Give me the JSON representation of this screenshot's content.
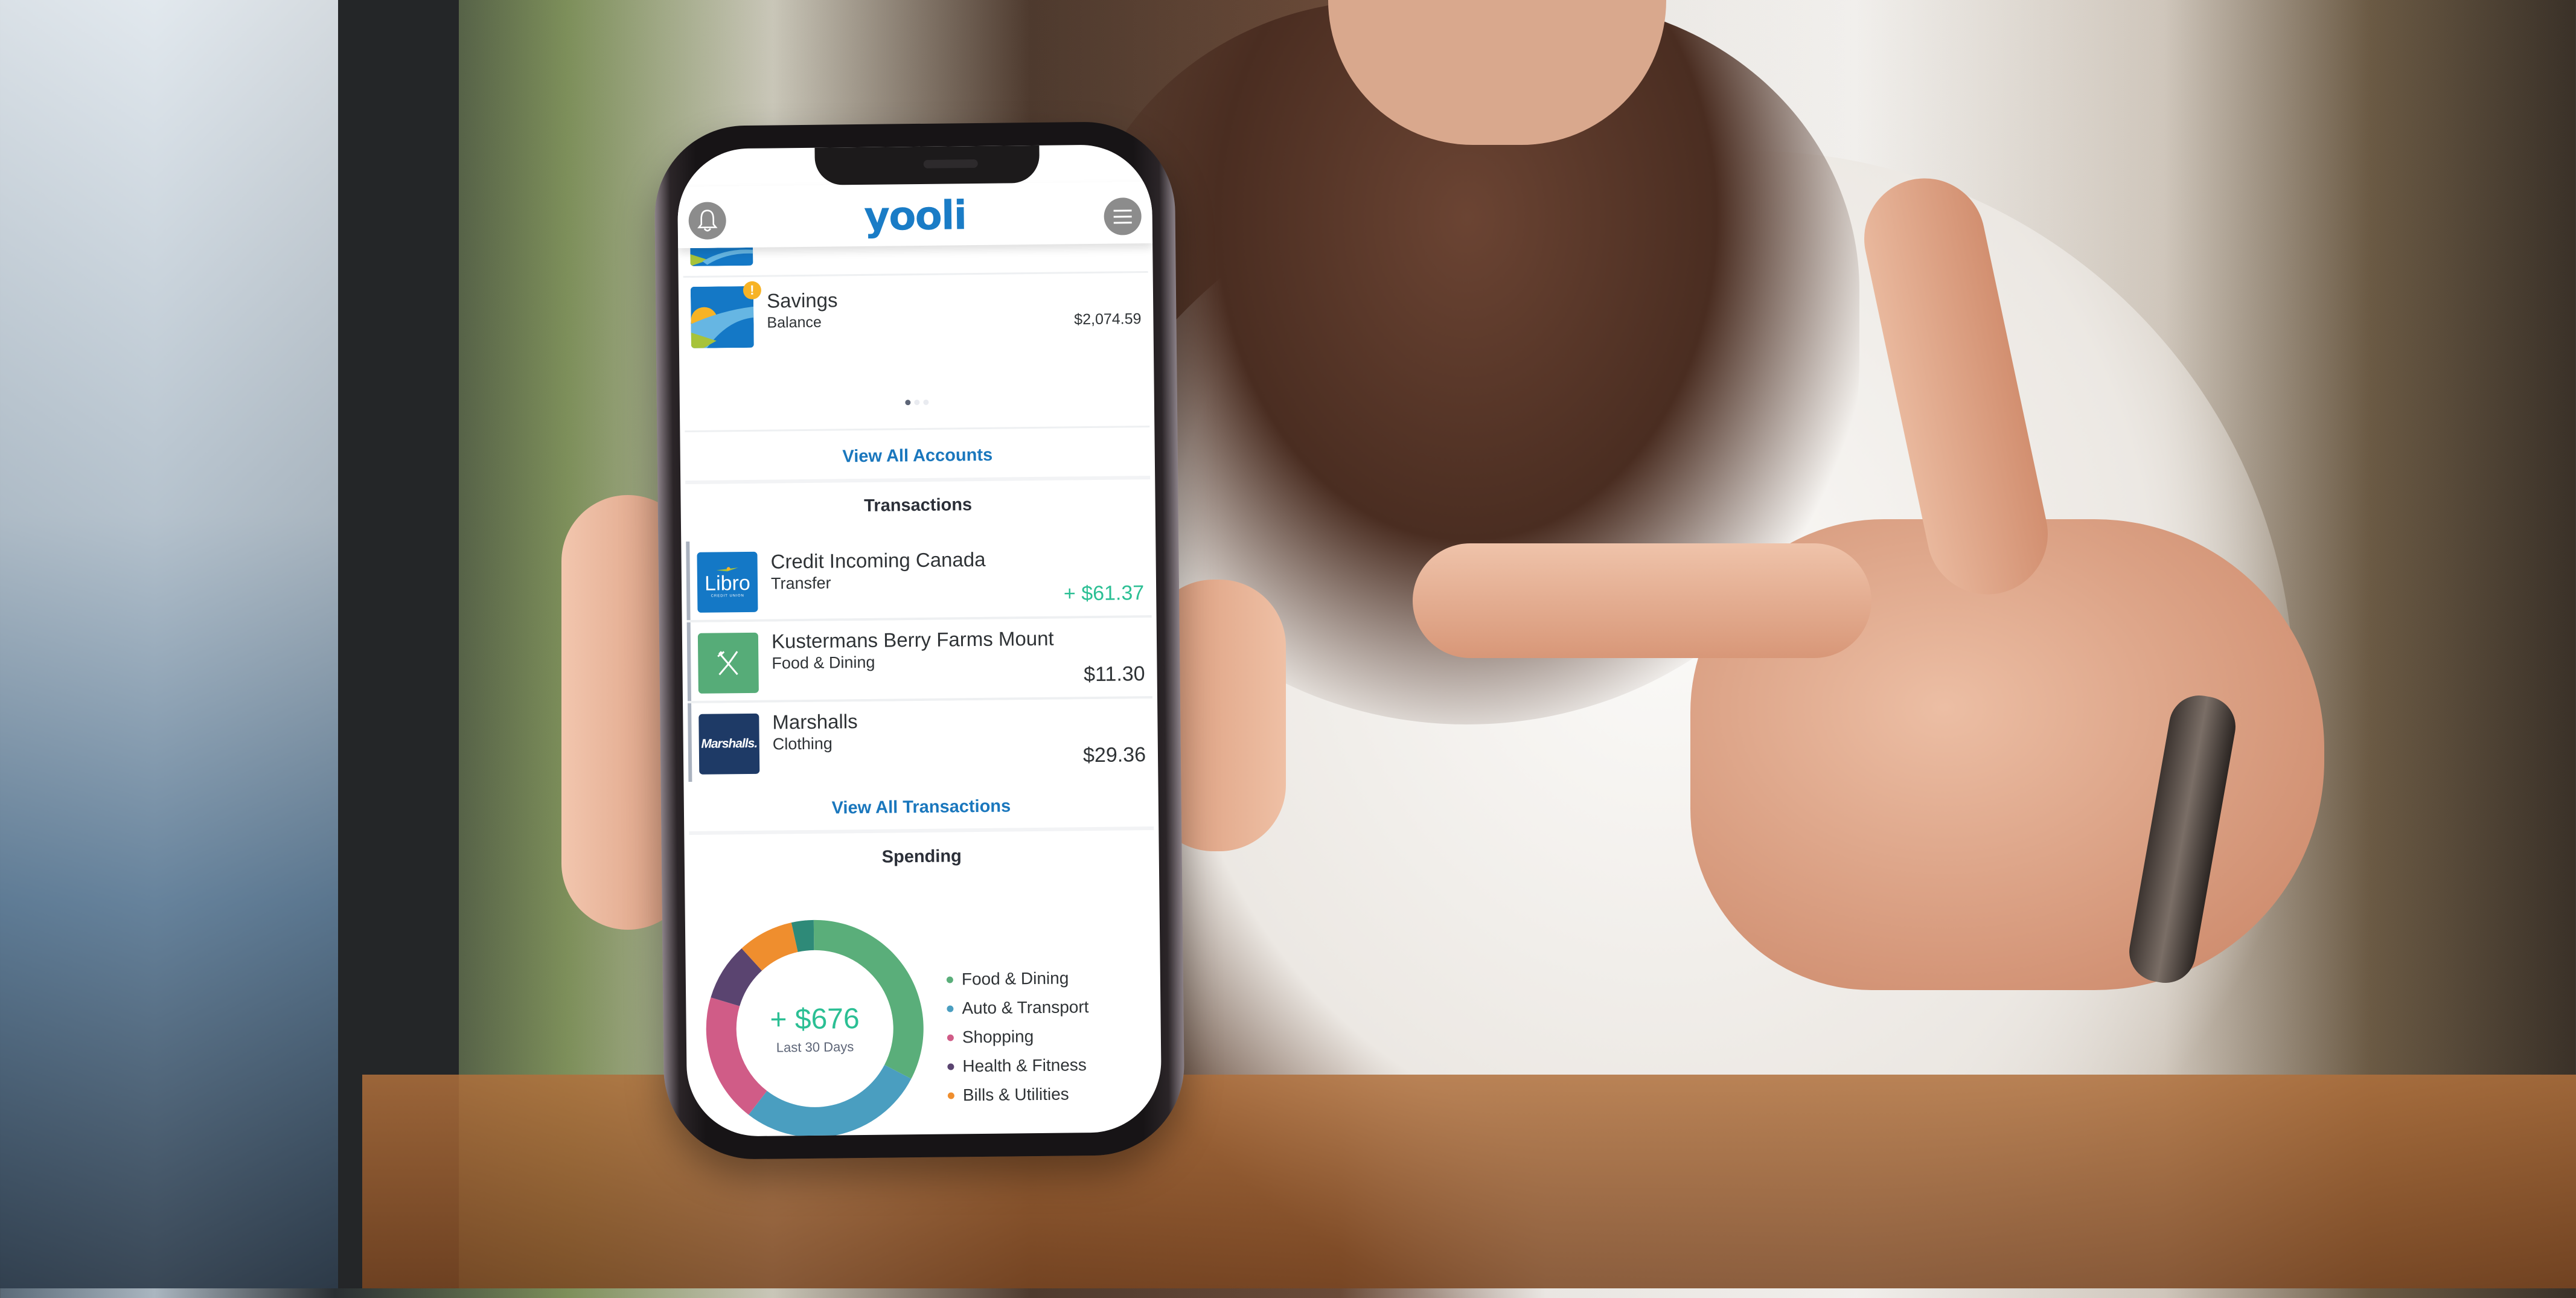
{
  "app": {
    "name": "yooli",
    "header": {
      "left_icon": "bell-icon",
      "right_icon": "hamburger-menu-icon"
    }
  },
  "accounts": {
    "items": [
      {
        "name": "Savings",
        "label": "Balance",
        "amount": "$2,074.59",
        "alert_badge": "!"
      }
    ],
    "carousel": {
      "count": 3,
      "active": 1
    },
    "view_all_label": "View All Accounts"
  },
  "transactions": {
    "title": "Transactions",
    "items": [
      {
        "merchant": "Credit Incoming Canada",
        "category": "Transfer",
        "amount": "+ $61.37",
        "direction": "credit",
        "logo_text": "Libro",
        "logo_subtext": "CREDIT UNION",
        "logo_color": "#1478c6"
      },
      {
        "merchant": "Kustermans Berry Farms Mount",
        "category": "Food & Dining",
        "amount": "$11.30",
        "direction": "debit",
        "logo_icon": "fork-knife-icon",
        "logo_color": "#56ac78"
      },
      {
        "merchant": "Marshalls",
        "category": "Clothing",
        "amount": "$29.36",
        "direction": "debit",
        "logo_text": "Marshalls.",
        "logo_color": "#1e3a66"
      }
    ],
    "view_all_label": "View All Transactions"
  },
  "spending": {
    "title": "Spending",
    "total": "+ $676",
    "period": "Last 30 Days",
    "carousel": {
      "count": 2,
      "active": 1
    }
  },
  "colors": {
    "brand": "#1a7cc6",
    "brand_light": "#5bb4e4",
    "positive": "#2bbf94",
    "link": "#1a77bd"
  },
  "chart_data": {
    "type": "pie",
    "variant": "donut",
    "title": "Spending",
    "center_label": "+ $676",
    "center_sublabel": "Last 30 Days",
    "legend_position": "right",
    "series": [
      {
        "name": "Food & Dining",
        "share_percent": 32.8,
        "color": "#5aae7a"
      },
      {
        "name": "Auto & Transport",
        "share_percent": 27.8,
        "color": "#4a9ec0"
      },
      {
        "name": "Shopping",
        "share_percent": 19.2,
        "color": "#d05c87"
      },
      {
        "name": "Health & Fitness",
        "share_percent": 8.6,
        "color": "#5a4470"
      },
      {
        "name": "Bills & Utilities",
        "share_percent": 8.3,
        "color": "#ef8e2e"
      },
      {
        "name": "Other",
        "share_percent": 3.3,
        "color": "#2e8a78",
        "in_legend": false
      }
    ]
  }
}
